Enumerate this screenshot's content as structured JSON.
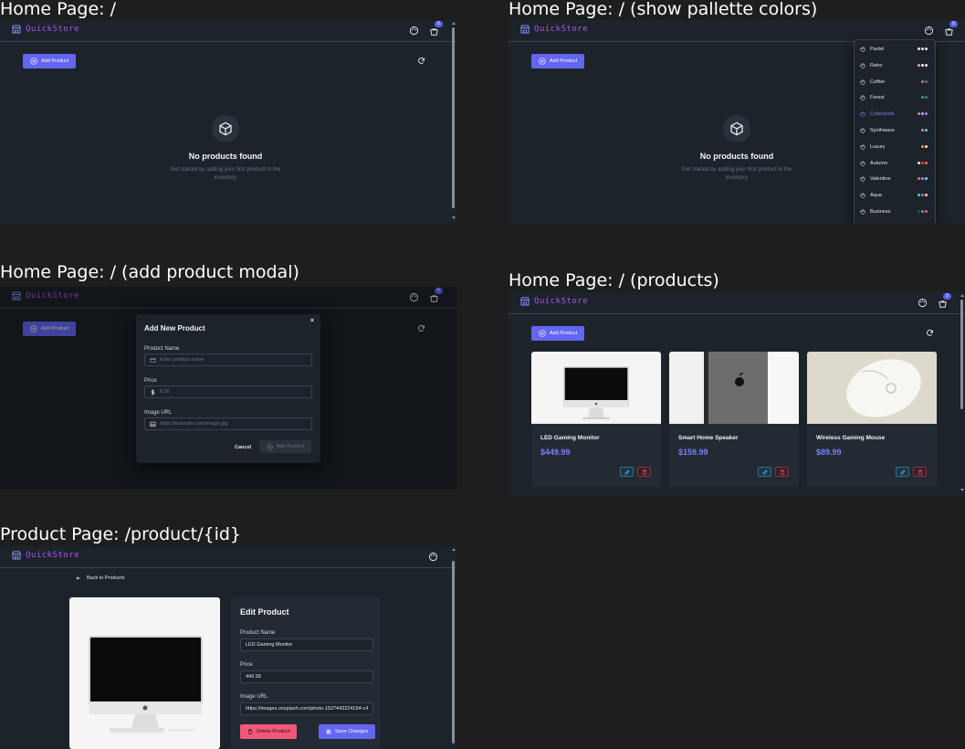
{
  "captions": {
    "home": "Home Page: /",
    "palette": "Home Page: / (show pallette colors)",
    "modal": "Home Page: / (add product modal)",
    "products": "Home Page: / (products)",
    "product": "Product Page: /product/{id}"
  },
  "app": {
    "name": "QuickStore",
    "cart_count": "0",
    "cart_count_products": "3",
    "add_product_label": "Add Product",
    "accent": "#6366f1",
    "brand": "#a855f7"
  },
  "empty_state": {
    "title": "No products found",
    "subtitle": "Get started by adding your first product to the inventory"
  },
  "themes": [
    {
      "name": "Pastel",
      "colors": [
        "#e5e7eb",
        "#e5e7eb",
        "#e5e7eb"
      ]
    },
    {
      "name": "Retro",
      "colors": [
        "#fca5a5",
        "#e5e7eb",
        "#e5e7eb"
      ]
    },
    {
      "name": "Coffee",
      "colors": [
        "#c08457",
        "#6b7280"
      ]
    },
    {
      "name": "Forest",
      "colors": [
        "#1eb854",
        "#6b7280"
      ]
    },
    {
      "name": "Cyberpunk",
      "colors": [
        "#ff7598",
        "#75d1f0",
        "#c07eec"
      ],
      "active": true
    },
    {
      "name": "Synthwave",
      "colors": [
        "#e779c1",
        "#58c7f3"
      ]
    },
    {
      "name": "Luxury",
      "colors": [
        "#f59e0b",
        "#e5e7eb"
      ]
    },
    {
      "name": "Autumn",
      "colors": [
        "#e5e7eb",
        "#ef4444",
        "#f97316"
      ]
    },
    {
      "name": "Valentine",
      "colors": [
        "#e96d7b",
        "#a991f7",
        "#88dbdd"
      ]
    },
    {
      "name": "Aqua",
      "colors": [
        "#09ecf3",
        "#966fb3",
        "#ffd6a7"
      ]
    },
    {
      "name": "Business",
      "colors": [
        "#1c4e80",
        "#7c909a",
        "#ea6947"
      ]
    }
  ],
  "modal": {
    "title": "Add New Product",
    "close_label": "×",
    "name_label": "Product Name",
    "name_placeholder": "Enter product name",
    "price_label": "Price",
    "price_placeholder": "0.00",
    "image_label": "Image URL",
    "image_placeholder": "https://example.com/image.jpg",
    "cancel_label": "Cancel",
    "submit_label": "Add Product"
  },
  "products": [
    {
      "name": "LED Gaming Monitor",
      "price": "$449.99"
    },
    {
      "name": "Smart Home Speaker",
      "price": "$159.99"
    },
    {
      "name": "Wireless Gaming Mouse",
      "price": "$89.99"
    }
  ],
  "product_page": {
    "back_label": "Back to Products",
    "edit_title": "Edit Product",
    "name_label": "Product Name",
    "name_value": "LED Gaming Monitor",
    "price_label": "Price",
    "price_value": "449.99",
    "image_label": "Image URL",
    "image_value": "https://images.unsplash.com/photo-1527443224154-c4",
    "delete_label": "Delete Product",
    "save_label": "Save Changes"
  }
}
